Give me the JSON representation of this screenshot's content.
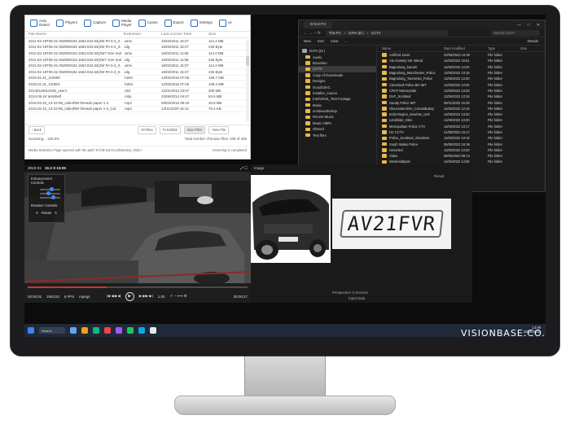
{
  "brand": "VISIONBASE.CO.UK",
  "app1": {
    "toolbar": [
      {
        "icon": "search-icon",
        "label": "Auto\nDetect"
      },
      {
        "icon": "players-icon",
        "label": "Players"
      },
      {
        "icon": "capture-icon",
        "label": "Capture"
      },
      {
        "icon": "media-player-icon",
        "label": "Media\nPlayer"
      },
      {
        "icon": "cases-icon",
        "label": "Cases"
      },
      {
        "icon": "export-icon",
        "label": "Export"
      },
      {
        "icon": "gear-icon",
        "label": "Settings"
      },
      {
        "icon": "shield-icon",
        "label": "v4"
      }
    ],
    "columns": [
      "File Name",
      "Extension",
      "Last Access Time",
      "Size"
    ],
    "rows": [
      [
        "2011-02-18T06-31-00Z900192.1663.032.63(2W PA 5-3_0.32)",
        ".wmv",
        "16/02/2011 15:27",
        "114.4 MB"
      ],
      [
        "2011-02-18T06-31-00Z900192.1663.032.63(2W PA 5-3_0.32)",
        ".idg",
        "16/02/2011 15:27",
        "226 Byte"
      ],
      [
        "2011-02-18T06-31-00Z900193.1663.032.63(2W7 Gen Suit 0B-0)",
        ".wmv",
        "16/02/2011 11:58",
        "114.0 MB"
      ],
      [
        "2011-02-18T06-31-00Z900193.1663.032.63(2W7 Gen Suit 0B-0)",
        ".idg",
        "16/02/2011 11:58",
        "226 Byte"
      ],
      [
        "2011-02-18T06-31-00Z900192.1663.032.63(2W PA 5-3_0.73)",
        ".wmv",
        "16/02/2011 15:07",
        "114.4 MB"
      ],
      [
        "2011-02-18T06-31-00Z900192.1663.032.63(2W PA 5-3_0.73)",
        ".idg",
        "16/02/2011 15:27",
        "226 Byte"
      ],
      [
        "2015.01.31_110000",
        ".h264",
        "12/02/2015 07:05",
        "106.7 MB"
      ],
      [
        "2015.01.31_120001",
        ".h264",
        "12/02/2015 07:05",
        "109.2 MB"
      ],
      [
        "20130110012038_user1",
        ".264",
        "12/01/2013 23:07",
        "200 MB"
      ],
      [
        "2014-06-24 testshelf",
        ".mkp",
        "23/06/2014 04:47",
        "84.6 MB"
      ],
      [
        "2015.03.10_13-22-55_videoRW threads paper 1-4",
        ".mp4",
        "09/03/2015 09:19",
        "40.9 MB"
      ],
      [
        "2015.03.10_13-22-55_videoRW threads paper 1-4_Cut",
        ".mp4",
        "14/11/2020 15:14",
        "70.4 KB"
      ]
    ],
    "nav": {
      "back": "Back",
      "all_files": "All Files",
      "to_exhibit": "To Exhibit",
      "size_filter": "Size Filter",
      "view_file": "View File"
    },
    "status_left": "Scanning... 100.0%",
    "status_right": "Total number of known files: 239 of 406",
    "status2_left": "Media Selection Page opened with the path 'D:\\VB Doc\\Confidential_Video'.",
    "status2_right": "Scanning is completed"
  },
  "app2": {
    "tab": "D:\\CCTV",
    "controls": [
      "—",
      "□",
      "✕"
    ],
    "path": [
      "This PC",
      "DATA (D:)",
      "CCTV"
    ],
    "search_placeholder": "Search CCTV",
    "cmd": [
      "New",
      "Sort",
      "View",
      "...",
      "Details"
    ],
    "side": [
      "DATA (D:)",
      "Audio",
      "Boxvideo",
      "CCTV",
      "Copy of Downloads",
      "Designs",
      "GoodGilVC",
      "Installer_source",
      "IntelVESK_Test Footage",
      "Music",
      "onsiteworkshop",
      "Recent Music",
      "Music HBRI",
      "Shared",
      "Test files"
    ],
    "columns": [
      "Name",
      "Date modified",
      "Type",
      "Size"
    ],
    "rows": [
      [
        "Ashford Janet",
        "23/06/2023 10:29",
        "File folder"
      ],
      [
        "Ato Gamely Intr Interal",
        "11/06/2022 15:51",
        "File folder"
      ],
      [
        "Bagnalong_kanal4",
        "11/06/2022 13:20",
        "File folder"
      ],
      [
        "Bagnalong_Manchester_Police",
        "11/06/2022 13:19",
        "File folder"
      ],
      [
        "Bagnalong_Tournesia_Police",
        "11/06/2022 13:20",
        "File folder"
      ],
      [
        "Cleveland Police BH IMT",
        "11/06/2022 13:20",
        "File folder"
      ],
      [
        "CRHT Merseyside",
        "11/06/2022 13:20",
        "File folder"
      ],
      [
        "DVF_Scotland",
        "11/06/2022 13:19",
        "File folder"
      ],
      [
        "Gandy Police IMT",
        "09/11/2022 15:29",
        "File folder"
      ],
      [
        "Gloucestershire_Constabulary",
        "11/06/2022 13:19",
        "File folder"
      ],
      [
        "India Region_Newrise_Unit",
        "11/06/2022 13:20",
        "File folder"
      ],
      [
        "Landslide_Glen",
        "11/06/2022 13:20",
        "File folder"
      ],
      [
        "Metropolitan Police CTV",
        "11/06/2022 13:17",
        "File folder"
      ],
      [
        "NX CCTV",
        "21/09/2022 15:17",
        "File folder"
      ],
      [
        "Police_Scotland_Aberdeen",
        "11/06/2022 13:19",
        "File folder"
      ],
      [
        "South Wales Police",
        "05/09/2022 15:36",
        "File folder"
      ],
      [
        "Unsorted",
        "11/06/2022 13:20",
        "File folder"
      ],
      [
        "Video",
        "09/05/2022 09:14",
        "File folder"
      ],
      [
        "Westmidlands",
        "11/06/2022 14:06",
        "File folder"
      ]
    ]
  },
  "player": {
    "title": "2023-01",
    "time_overlay": "15:2 8 15:05",
    "enhancement_label": "Enhancement Controls",
    "rotation_label": "Rotation Controls",
    "rotate_left": "Rotate",
    "current_time": "00:00:02",
    "end_time": "00:00:27",
    "frame": "190/222",
    "fps": "8 FPS",
    "codec": "mpeg4",
    "speed": "1.00",
    "progress": 0.36
  },
  "vehicle": {
    "image_header": "Image",
    "plate_text": "AV21FVR",
    "perspective_label": "Perspective Corrected",
    "result_label": "Result",
    "input_label": "Input Data"
  },
  "taskbar": {
    "search": "Search",
    "clock_time": "13:09",
    "clock_date": "28/06/2023"
  }
}
